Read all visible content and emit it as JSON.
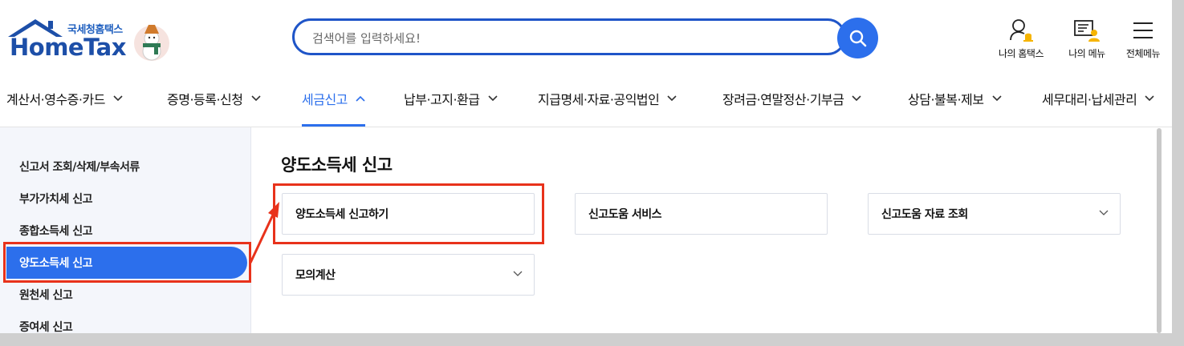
{
  "header": {
    "logo_small": "국세청홈택스",
    "logo_main": "HomeTax",
    "search_placeholder": "검색어를 입력하세요!",
    "utils": [
      {
        "label": "나의 홈택스",
        "icon": "user-bell-icon"
      },
      {
        "label": "나의 메뉴",
        "icon": "user-list-icon"
      },
      {
        "label": "전체메뉴",
        "icon": "hamburger-menu-icon"
      }
    ]
  },
  "nav": {
    "items": [
      {
        "label": "계산서·영수증·카드",
        "icon": "chevron-down-icon"
      },
      {
        "label": "증명·등록·신청",
        "icon": "chevron-down-icon"
      },
      {
        "label": "세금신고",
        "icon": "chevron-up-icon",
        "active": true
      },
      {
        "label": "납부·고지·환급",
        "icon": "chevron-down-icon"
      },
      {
        "label": "지급명세·자료·공익법인",
        "icon": "chevron-down-icon"
      },
      {
        "label": "장려금·연말정산·기부금",
        "icon": "chevron-down-icon"
      },
      {
        "label": "상담·불복·제보",
        "icon": "chevron-down-icon"
      },
      {
        "label": "세무대리·납세관리",
        "icon": "chevron-down-icon"
      }
    ]
  },
  "sidebar": {
    "items": [
      {
        "label": "신고서 조회/삭제/부속서류"
      },
      {
        "label": "부가가치세 신고"
      },
      {
        "label": "종합소득세 신고"
      },
      {
        "label": "양도소득세 신고",
        "active": true
      },
      {
        "label": "원천세 신고"
      },
      {
        "label": "증여세 신고"
      }
    ]
  },
  "main": {
    "title": "양도소득세 신고",
    "cards": [
      {
        "label": "양도소득세 신고하기",
        "expandable": false
      },
      {
        "label": "신고도움 서비스",
        "expandable": false
      },
      {
        "label": "신고도움 자료 조회",
        "expandable": true
      },
      {
        "label": "모의계산",
        "expandable": true
      }
    ]
  },
  "colors": {
    "accent": "#2c6fec",
    "highlight": "#e8321b",
    "brand": "#1d4fa8"
  }
}
